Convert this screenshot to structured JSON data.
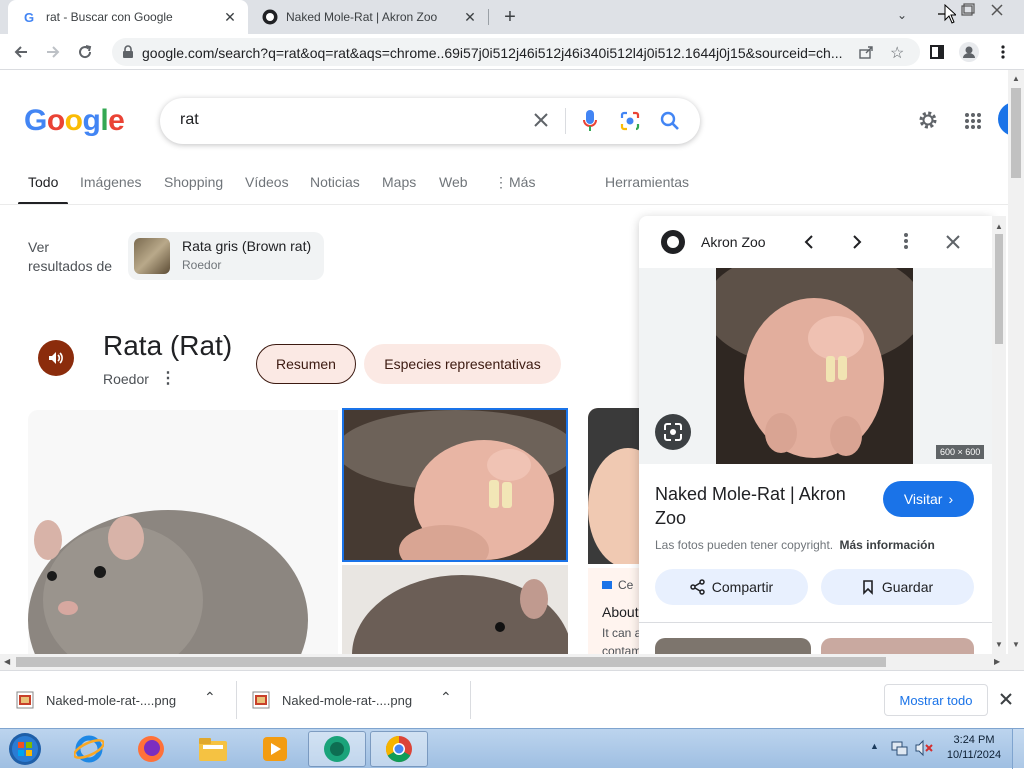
{
  "browser": {
    "tabs": [
      {
        "title": "rat - Buscar con Google",
        "active": true
      },
      {
        "title": "Naked Mole-Rat | Akron Zoo",
        "active": false
      }
    ],
    "url": "google.com/search?q=rat&oq=rat&aqs=chrome..69i57j0i512j46i512j46i340i512l4j0i512.1644j0j15&sourceid=ch..."
  },
  "google": {
    "logo": "Google",
    "query": "rat",
    "nav": [
      "Todo",
      "Imágenes",
      "Shopping",
      "Vídeos",
      "Noticias",
      "Maps",
      "Web",
      "Más",
      "Herramientas"
    ],
    "see_results": {
      "label_line1": "Ver",
      "label_line2": "resultados de",
      "chip_title": "Rata gris (Brown rat)",
      "chip_sub": "Roedor"
    },
    "knowledge": {
      "title": "Rata (Rat)",
      "subtitle": "Roedor",
      "chips": [
        "Resumen",
        "Especies representativas"
      ]
    },
    "snippet": {
      "source": "Ce",
      "title": "About",
      "text1": "It can a",
      "text2": "contam"
    }
  },
  "panel": {
    "source": "Akron Zoo",
    "dimensions": "600 × 600",
    "title": "Naked Mole-Rat | Akron Zoo",
    "visit_label": "Visitar",
    "copyright": "Las fotos pueden tener copyright.",
    "more_info": "Más información",
    "share_label": "Compartir",
    "save_label": "Guardar"
  },
  "downloads": {
    "items": [
      "Naked-mole-rat-....png",
      "Naked-mole-rat-....png"
    ],
    "show_all": "Mostrar todo"
  },
  "taskbar": {
    "time": "3:24 PM",
    "date": "10/11/2024"
  }
}
